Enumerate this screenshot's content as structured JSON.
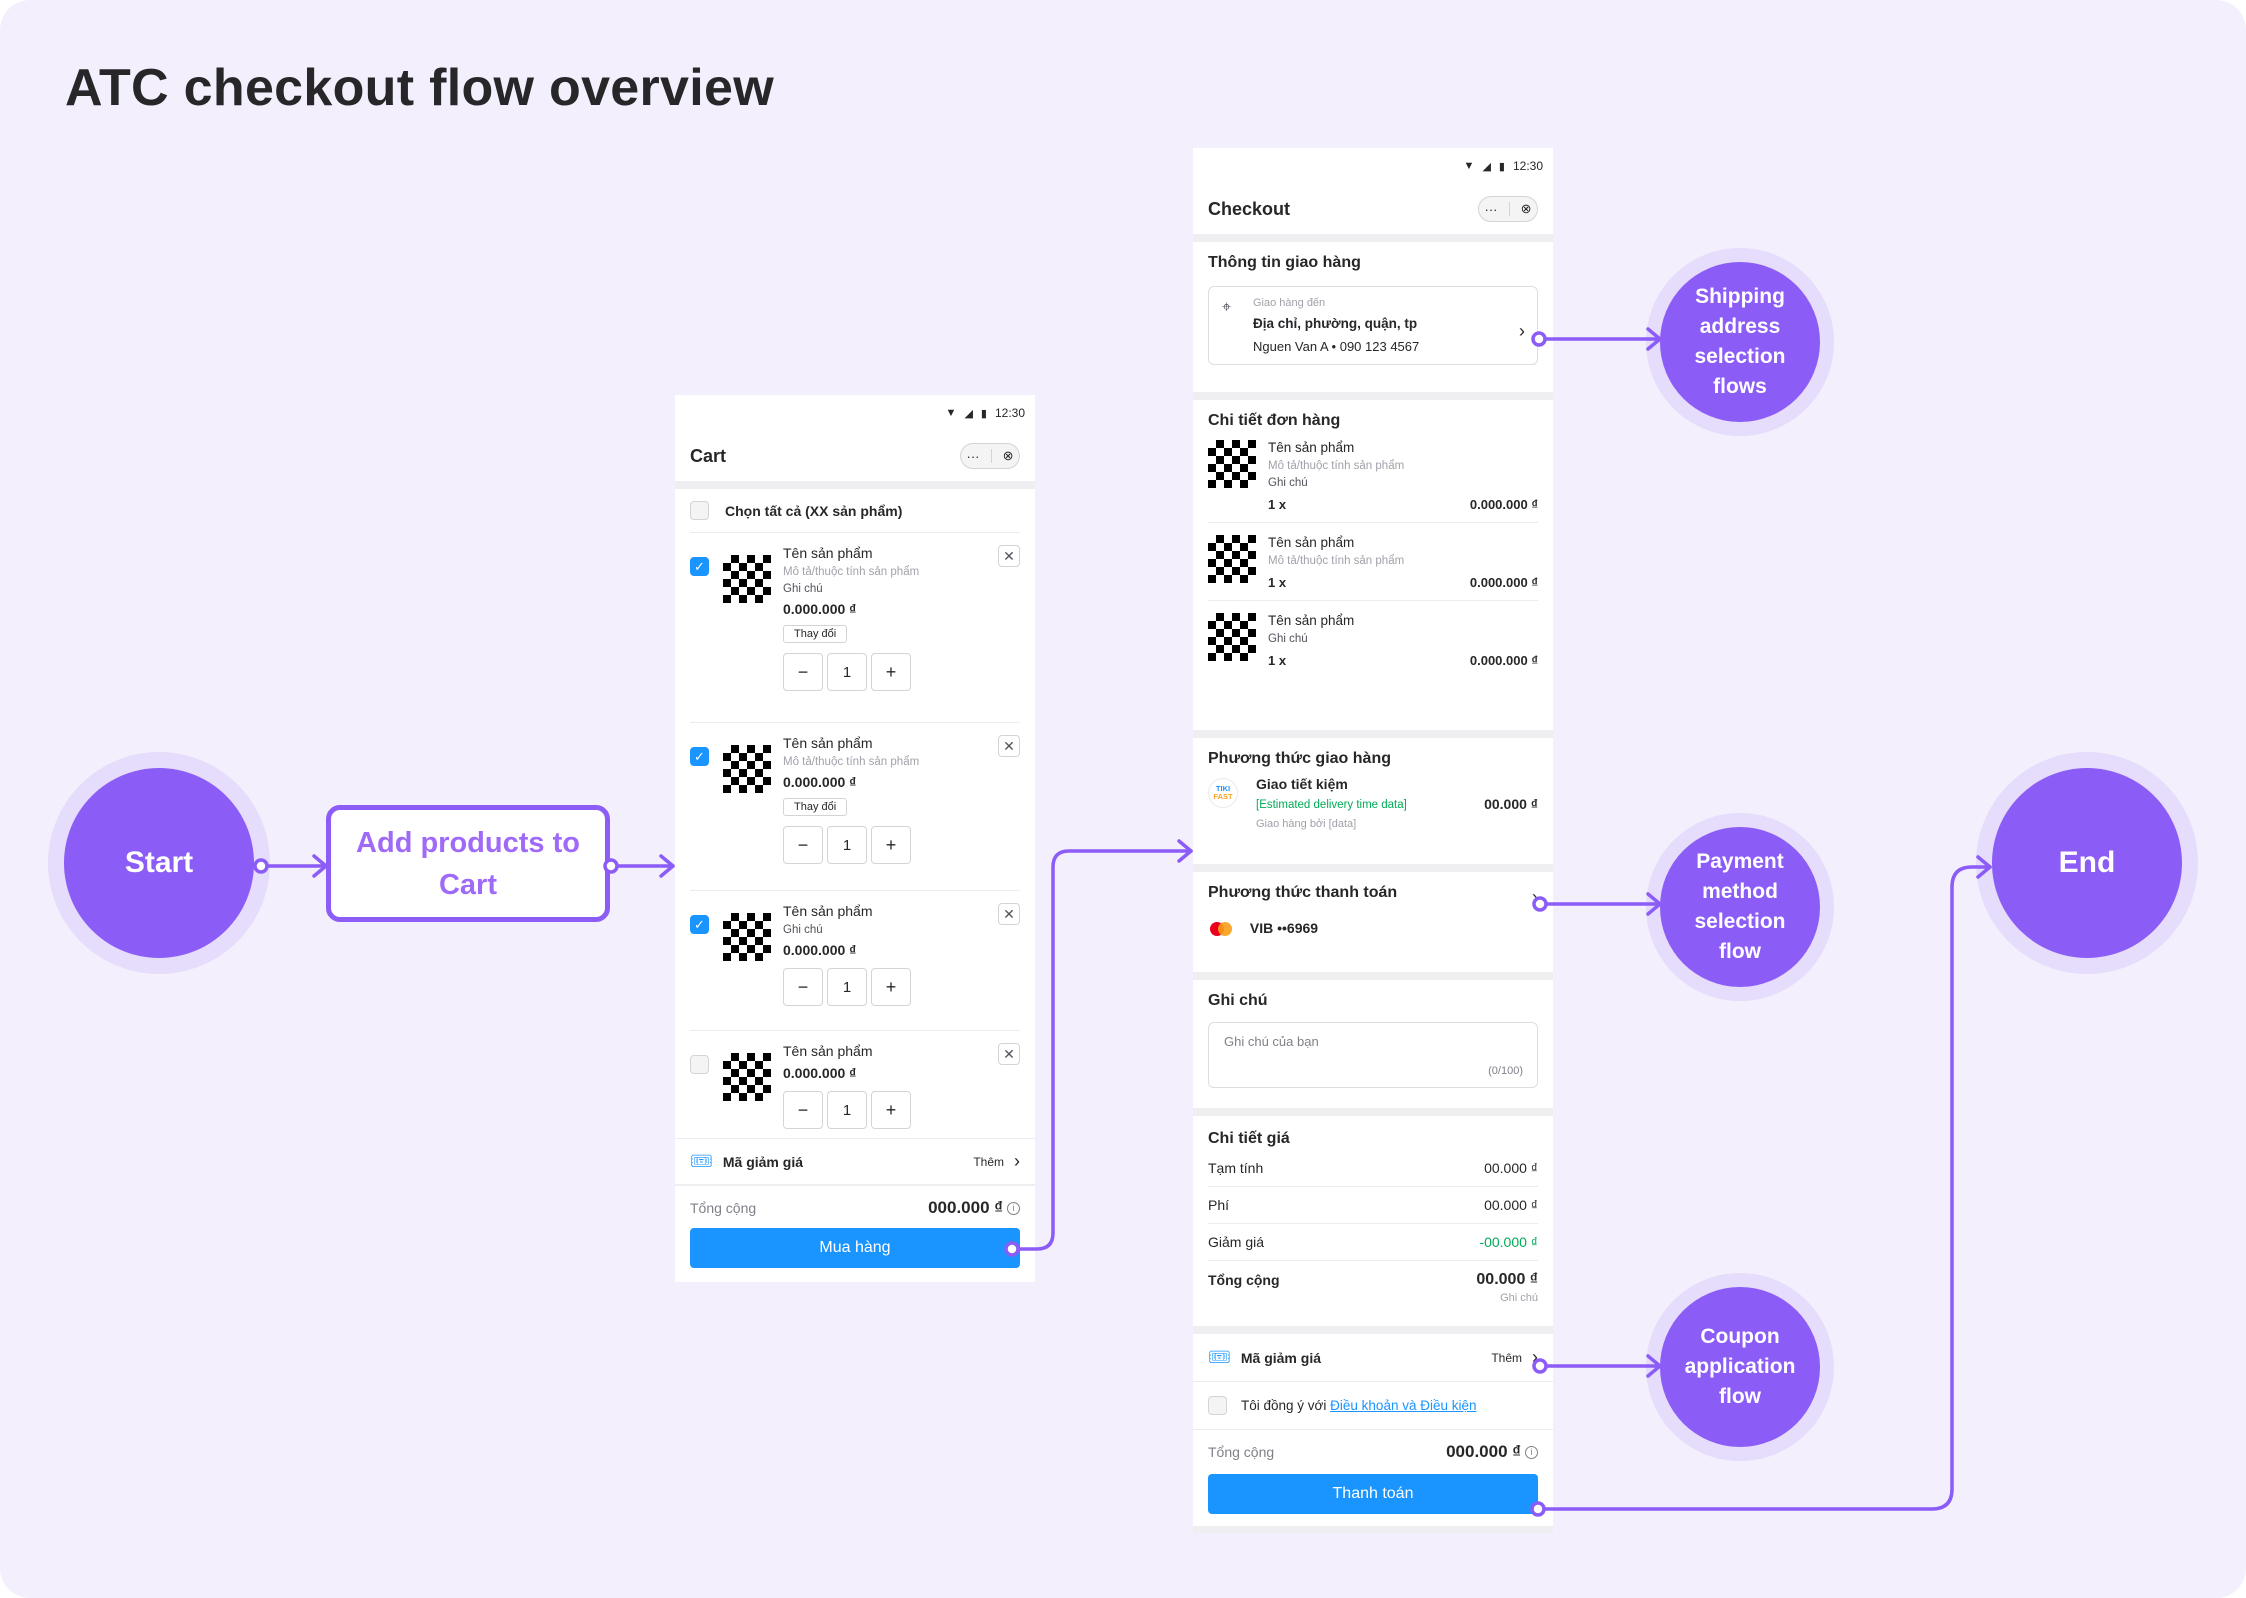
{
  "title": "ATC checkout flow overview",
  "colors": {
    "accent": "#8b5cf6",
    "halo": "#e6dcfb",
    "cta_blue": "#1a94ff",
    "canvas": "#f3effd",
    "success_green": "#00ab56"
  },
  "nodes": {
    "start": "Start",
    "add_products": "Add products to Cart",
    "shipping_flow": "Shipping address selection flows",
    "payment_flow": "Payment method selection flow",
    "coupon_flow": "Coupon application flow",
    "end": "End"
  },
  "status_time": "12:30",
  "cart": {
    "title": "Cart",
    "nav_more": "···",
    "nav_close": "⊗",
    "select_all": "Chọn tất cả (XX sản phẩm)",
    "items": [
      {
        "checked": true,
        "name": "Tên sản phẩm",
        "desc": "Mô tả/thuộc tính sản phẩm",
        "note": "Ghi chú",
        "price": "0.000.000 ₫",
        "change": "Thay đổi",
        "qty": "1"
      },
      {
        "checked": true,
        "name": "Tên sản phẩm",
        "desc": "Mô tả/thuộc tính sản phẩm",
        "price": "0.000.000 ₫",
        "change": "Thay đổi",
        "qty": "1"
      },
      {
        "checked": true,
        "name": "Tên sản phẩm",
        "note": "Ghi chú",
        "price": "0.000.000 ₫",
        "qty": "1"
      },
      {
        "checked": false,
        "name": "Tên sản phẩm",
        "price": "0.000.000 ₫",
        "qty": "1"
      }
    ],
    "coupon_label": "Mã giảm giá",
    "coupon_add": "Thêm",
    "total_label": "Tổng cộng",
    "total_value": "000.000 ₫",
    "cta": "Mua hàng"
  },
  "checkout": {
    "title": "Checkout",
    "nav_more": "···",
    "nav_close": "⊗",
    "shipping_info_title": "Thông tin giao hàng",
    "deliver_to": "Giao hàng đến",
    "address": "Địa chỉ, phường, quận, tp",
    "recipient": "Nguen Van A • 090 123 4567",
    "order_detail_title": "Chi tiết đơn hàng",
    "order_items": [
      {
        "name": "Tên sản phẩm",
        "desc": "Mô tả/thuộc tính sản phẩm",
        "note": "Ghi chú",
        "qty": "1 x",
        "price": "0.000.000 ₫"
      },
      {
        "name": "Tên sản phẩm",
        "desc": "Mô tả/thuộc tính sản phẩm",
        "qty": "1 x",
        "price": "0.000.000 ₫"
      },
      {
        "name": "Tên sản phẩm",
        "note": "Ghi chú",
        "qty": "1 x",
        "price": "0.000.000 ₫"
      }
    ],
    "shipping_method_title": "Phương thức giao hàng",
    "shipping_logo_top": "TIKI",
    "shipping_logo_bottom": "FAST",
    "shipping_name": "Giao tiết kiệm",
    "shipping_estimate": "[Estimated delivery time data]",
    "shipping_by": "Giao hàng bởi [data]",
    "shipping_price": "00.000 ₫",
    "payment_title": "Phương thức thanh toán",
    "payment_card": "VIB ••6969",
    "note_title": "Ghi chú",
    "note_placeholder": "Ghi chú của bạn",
    "note_counter": "(0/100)",
    "price_detail_title": "Chi tiết giá",
    "price_rows": [
      {
        "label": "Tạm tính",
        "value": "00.000 ₫"
      },
      {
        "label": "Phí",
        "value": "00.000 ₫"
      },
      {
        "label": "Giảm giá",
        "value": "-00.000 ₫"
      }
    ],
    "price_total_label": "Tổng cộng",
    "price_total_value": "00.000 ₫",
    "price_total_note": "Ghi chú",
    "coupon_label": "Mã giảm giá",
    "coupon_add": "Thêm",
    "agree_prefix": "Tôi đồng ý với ",
    "agree_link": "Điều khoản và Điều kiện",
    "total_label": "Tổng cộng",
    "total_value": "000.000 ₫",
    "cta": "Thanh toán"
  }
}
